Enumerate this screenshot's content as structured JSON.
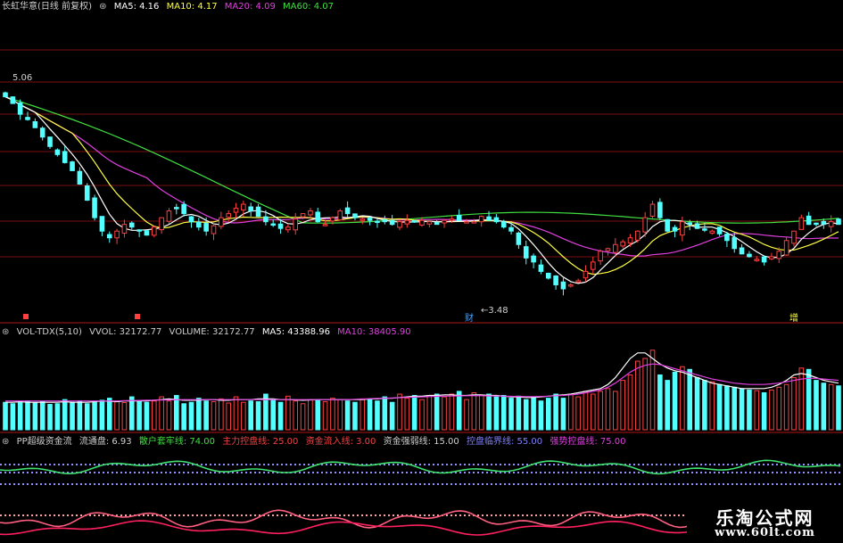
{
  "main_header": {
    "title": "长虹华意(日线 前复权)",
    "ma5": "MA5: 4.16",
    "ma10": "MA10: 4.17",
    "ma20": "MA20: 4.09",
    "ma60": "MA60: 4.07"
  },
  "price_labels": {
    "high": "5.06",
    "low": "3.48"
  },
  "event_markers": {
    "cai": "财",
    "zeng": "增"
  },
  "vol_header": {
    "title": "VOL-TDX(5,10)",
    "vvol": "VVOL: 32172.77",
    "volume": "VOLUME: 32172.77",
    "ma5": "MA5: 43388.96",
    "ma10": "MA10: 38405.90"
  },
  "pp_header": {
    "title": "PP超级资金流",
    "liutong": "流通盘: 6.93",
    "sanhu": "散户套牢线: 74.00",
    "zhuli": "主力控盘线: 25.00",
    "zijin": "资金流入线: 3.00",
    "qiangruo": "资金强弱线: 15.00",
    "linjie": "控盘临界线: 55.00",
    "qiangshi": "强势控盘线: 75.00"
  },
  "watermark": {
    "name": "乐淘公式网",
    "url": "www.60lt.com"
  },
  "colors": {
    "up": "#ff4040",
    "down": "#54ffff",
    "ma5": "#ffffff",
    "ma10": "#ffff40",
    "ma20": "#e040e0",
    "ma60": "#40e040",
    "grid": "#7a1010"
  },
  "chart_data": {
    "type": "candlestick",
    "close": [
      4.95,
      4.9,
      4.82,
      4.78,
      4.72,
      4.65,
      4.58,
      4.52,
      4.46,
      4.4,
      4.3,
      4.18,
      4.05,
      3.95,
      3.9,
      3.95,
      4.0,
      3.98,
      3.95,
      3.92,
      3.98,
      4.05,
      4.1,
      4.12,
      4.08,
      4.02,
      3.98,
      3.95,
      3.99,
      4.05,
      4.08,
      4.12,
      4.15,
      4.1,
      4.06,
      4.02,
      4.0,
      3.97,
      3.98,
      4.04,
      4.08,
      4.1,
      4.02,
      4.0,
      4.05,
      4.1,
      4.08,
      4.05,
      4.04,
      4.03,
      4.02,
      4.02,
      4.0,
      4.02,
      4.03,
      4.02,
      4.03,
      4.02,
      4.0,
      4.03,
      4.04,
      4.03,
      4.02,
      4.02,
      4.06,
      4.03,
      4.02,
      3.98,
      3.95,
      3.85,
      3.75,
      3.72,
      3.65,
      3.6,
      3.55,
      3.52,
      3.55,
      3.58,
      3.65,
      3.72,
      3.8,
      3.82,
      3.85,
      3.87,
      3.9,
      3.95,
      4.05,
      4.15,
      4.05,
      3.95,
      3.95,
      4.02,
      4.0,
      3.97,
      3.96,
      3.95,
      3.93,
      3.88,
      3.82,
      3.78,
      3.76,
      3.74,
      3.72,
      3.76,
      3.8,
      3.88,
      3.95,
      4.05,
      4.0,
      4.0,
      4.0,
      4.02,
      4.0
    ],
    "volume": [
      20000,
      19000,
      20000,
      21000,
      19500,
      20500,
      18500,
      19000,
      22000,
      20000,
      21000,
      19000,
      20000,
      21500,
      23000,
      20500,
      19800,
      24000,
      21000,
      20000,
      21000,
      24000,
      21000,
      25000,
      19000,
      20000,
      23000,
      21000,
      20500,
      22500,
      19500,
      24000,
      20000,
      21000,
      20500,
      26000,
      22000,
      20000,
      24500,
      21000,
      19000,
      22000,
      21500,
      20500,
      23000,
      22000,
      21000,
      20000,
      22500,
      22500,
      21000,
      24000,
      20000,
      26000,
      23000,
      25000,
      22000,
      25000,
      26000,
      24000,
      26000,
      28000,
      22000,
      27000,
      25000,
      26000,
      24000,
      25000,
      23000,
      24500,
      22000,
      24000,
      21000,
      23000,
      26000,
      23000,
      26000,
      24000,
      28000,
      26000,
      28000,
      30000,
      28000,
      36000,
      40000,
      50000,
      52000,
      58000,
      40000,
      36000,
      42000,
      46000,
      44000,
      38000,
      36000,
      35000,
      33000,
      32000,
      31000,
      30000,
      29000,
      28500,
      27000,
      29000,
      31000,
      33000,
      38000,
      45000,
      44000,
      36000,
      34000,
      33000,
      32000
    ],
    "vol_ma5": [
      20000,
      20000,
      20500,
      20000,
      20000,
      20000,
      20000,
      20000,
      20500,
      20000,
      20000,
      20000,
      20500,
      21000,
      20800,
      20500,
      21000,
      21000,
      21000,
      21000,
      21500,
      22000,
      22500,
      22000,
      21500,
      21500,
      21500,
      22000,
      22000,
      21500,
      21500,
      22000,
      22000,
      22000,
      22500,
      22500,
      22500,
      22000,
      22000,
      21800,
      21500,
      21800,
      22000,
      22000,
      22000,
      22000,
      22000,
      22000,
      22000,
      22500,
      22500,
      23000,
      23000,
      23500,
      24000,
      24500,
      24500,
      25000,
      25000,
      25500,
      25500,
      25000,
      25000,
      25500,
      25500,
      25000,
      25000,
      24500,
      24000,
      24000,
      23500,
      23500,
      24000,
      24500,
      25000,
      25500,
      26000,
      27000,
      28000,
      29000,
      30000,
      33000,
      38000,
      45000,
      52000,
      56000,
      56000,
      52000,
      48000,
      45000,
      43000,
      42000,
      40000,
      38000,
      36000,
      34000,
      33000,
      32000,
      31000,
      30000,
      30000,
      30000,
      30000,
      31000,
      33000,
      36000,
      40000,
      41000,
      40000,
      38000,
      36000,
      35000,
      34000
    ],
    "vol_ma10": [
      21000,
      21000,
      21000,
      21000,
      21000,
      21000,
      21000,
      21000,
      21000,
      21000,
      21000,
      21000,
      21000,
      21000,
      21000,
      21000,
      21200,
      21300,
      21400,
      21500,
      21600,
      21700,
      21800,
      21900,
      22000,
      22000,
      22000,
      22000,
      22000,
      22000,
      22000,
      22000,
      22000,
      22000,
      22000,
      22000,
      22000,
      22000,
      22000,
      22000,
      22000,
      22000,
      22000,
      22000,
      22000,
      22000,
      22000,
      22200,
      22400,
      22600,
      22800,
      23000,
      23200,
      23400,
      23600,
      23800,
      24000,
      24200,
      24400,
      24500,
      24600,
      24700,
      24800,
      24800,
      24800,
      24700,
      24600,
      24500,
      24400,
      24300,
      24200,
      24200,
      24300,
      24500,
      24800,
      25000,
      25500,
      26000,
      27000,
      28000,
      29000,
      31000,
      34000,
      38000,
      42000,
      45000,
      47000,
      48000,
      47500,
      46000,
      44500,
      43000,
      41500,
      40000,
      38500,
      37000,
      36000,
      35000,
      34000,
      33500,
      33000,
      33000,
      33000,
      33500,
      34000,
      35000,
      36000,
      37000,
      37500,
      37500,
      37000,
      36500,
      36000
    ]
  }
}
